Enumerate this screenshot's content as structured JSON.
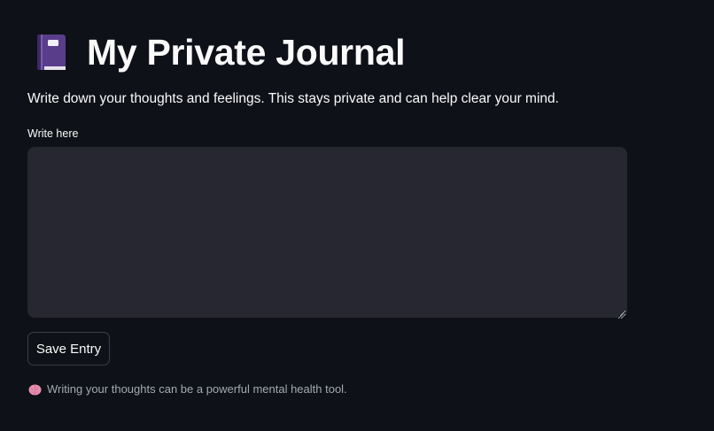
{
  "header": {
    "icon": "notebook-icon",
    "title": "My Private Journal"
  },
  "description": "Write down your thoughts and feelings. This stays private and can help clear your mind.",
  "journal_input": {
    "label": "Write here",
    "value": "",
    "placeholder": ""
  },
  "actions": {
    "save_label": "Save Entry"
  },
  "footer": {
    "icon": "brain-icon",
    "caption": "Writing your thoughts can be a powerful mental health tool."
  },
  "colors": {
    "background": "#0e1117",
    "input_background": "#262730",
    "text": "#fafafa",
    "caption_text": "#a3a8b4",
    "book_accent": "#6b4a9e"
  }
}
